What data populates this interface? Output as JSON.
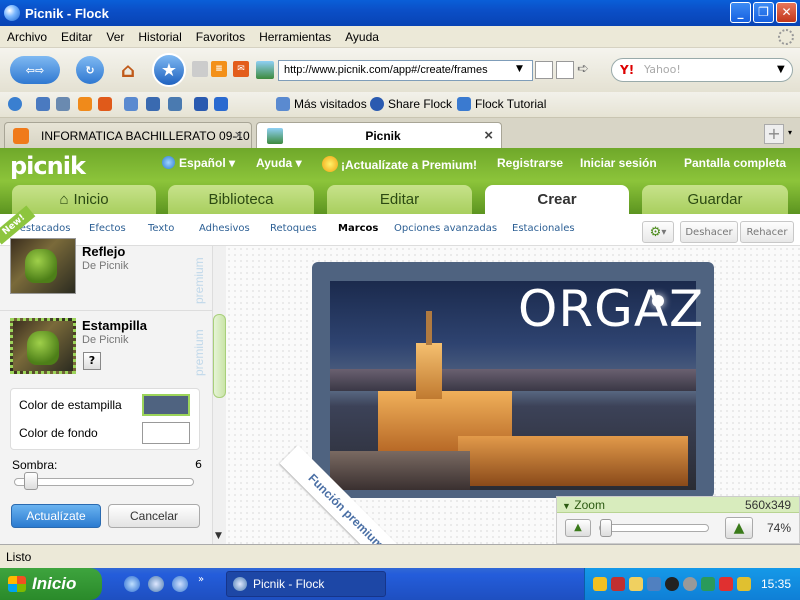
{
  "window": {
    "title": "Picnik - Flock",
    "min": "_",
    "max": "❐",
    "close": "✕"
  },
  "menu": [
    "Archivo",
    "Editar",
    "Ver",
    "Historial",
    "Favoritos",
    "Herramientas",
    "Ayuda"
  ],
  "nav": {
    "url": "http://www.picnik.com/app#/create/frames",
    "search_placeholder": "Yahoo!"
  },
  "bookmarks": [
    "Más visitados",
    "Share Flock",
    "Flock Tutorial"
  ],
  "tabs": [
    {
      "label": "INFORMATICA BACHILLERATO 09-10",
      "close": "×"
    },
    {
      "label": "Picnik",
      "close": "×"
    }
  ],
  "picnik": {
    "logo": "picnik",
    "top_links": {
      "language": "Español ▾",
      "help": "Ayuda ▾",
      "premium": "¡Actualízate a Premium!",
      "register": "Registrarse",
      "login": "Iniciar sesión",
      "fullscreen": "Pantalla completa"
    },
    "main_tabs": [
      "Inicio",
      "Biblioteca",
      "Editar",
      "Crear",
      "Guardar"
    ],
    "sub_tabs": [
      "Destacados",
      "Efectos",
      "Texto",
      "Adhesivos",
      "Retoques",
      "Marcos",
      "Opciones avanzadas",
      "Estacionales"
    ],
    "new_badge": "New!",
    "undo": "Deshacer",
    "redo": "Rehacer",
    "effects": [
      {
        "title": "Reflejo",
        "by": "De Picnik",
        "badge": "premium"
      },
      {
        "title": "Estampilla",
        "by": "De Picnik",
        "badge": "premium",
        "help": "?"
      }
    ],
    "stamp_color_label": "Color de estampilla",
    "stamp_color": "#4f6380",
    "bg_color_label": "Color de fondo",
    "bg_color": "#ffffff",
    "shadow_label": "Sombra:",
    "shadow_value": "6",
    "shadow_level": 0.06,
    "upgrade_button": "Actualízate",
    "cancel_button": "Cancelar",
    "canvas_text": "ORGAZ",
    "ribbon": "Función premium",
    "zoom_label": "Zoom",
    "dimensions": "560x349",
    "zoom_percent": "74%",
    "zoom_level": 0.74
  },
  "status": "Listo",
  "taskbar": {
    "start": "Inicio",
    "item": "Picnik - Flock",
    "time": "15:35"
  },
  "colors": {
    "xp_blue": "#0b4fc7",
    "picnik_green": "#8cc43a",
    "upgrade_blue": "#3a8ed8",
    "stamp": "#4f6380"
  }
}
